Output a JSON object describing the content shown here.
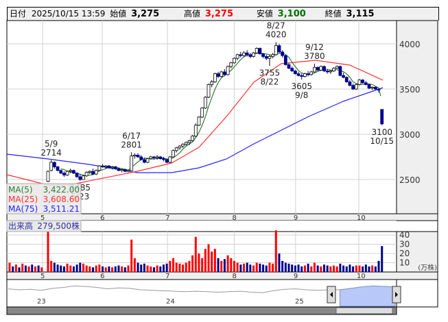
{
  "header": {
    "date_label": "日付",
    "datetime": "2025/10/15 13:59",
    "open_label": "始値",
    "open": "3,275",
    "high_label": "高値",
    "high": "3,275",
    "low_label": "安値",
    "low": "3,100",
    "close_label": "終値",
    "close": "3,115"
  },
  "legend": {
    "ma5_label": "MA(5)",
    "ma5_value": "3,422.00",
    "ma25_label": "MA(25)",
    "ma25_value": "3,608.60",
    "ma75_label": "MA(75)",
    "ma75_value": "3,511.21",
    "volume_label": "出来高",
    "volume_value": "279,500株"
  },
  "colors": {
    "up": "#ff0000",
    "down": "#00008b",
    "ma5": "#2e7d32",
    "ma25": "#ff3030",
    "ma75": "#2020ff",
    "flat": "#999999"
  },
  "chart_data": {
    "type": "candlestick",
    "price_axis": {
      "ticks": [
        "2500",
        "3000",
        "3500",
        "4000"
      ],
      "range": [
        2100,
        4200
      ]
    },
    "volume_axis": {
      "ticks": [
        "10",
        "20",
        "30",
        "40"
      ],
      "unit": "(万株)",
      "range": [
        0,
        42
      ]
    },
    "months": [
      {
        "label": "5",
        "i": -1.7
      },
      {
        "label": "6",
        "i": 16.9
      },
      {
        "label": "7",
        "i": 37.2
      },
      {
        "label": "8",
        "i": 58
      },
      {
        "label": "9",
        "i": 77.1
      },
      {
        "label": "10",
        "i": 96.8
      }
    ],
    "candles": [
      [
        2480,
        2600,
        2470,
        2590
      ],
      [
        2600,
        2714,
        2590,
        2690
      ],
      [
        2690,
        2700,
        2620,
        2640
      ],
      [
        2640,
        2650,
        2590,
        2600
      ],
      [
        2600,
        2610,
        2560,
        2570
      ],
      [
        2570,
        2590,
        2530,
        2550
      ],
      [
        2550,
        2600,
        2540,
        2590
      ],
      [
        2590,
        2620,
        2570,
        2600
      ],
      [
        2600,
        2610,
        2560,
        2570
      ],
      [
        2570,
        2580,
        2520,
        2530
      ],
      [
        2530,
        2560,
        2485,
        2500
      ],
      [
        2500,
        2550,
        2495,
        2540
      ],
      [
        2540,
        2590,
        2530,
        2580
      ],
      [
        2580,
        2600,
        2560,
        2590
      ],
      [
        2590,
        2620,
        2550,
        2560
      ],
      [
        2560,
        2610,
        2550,
        2600
      ],
      [
        2600,
        2660,
        2590,
        2650
      ],
      [
        2650,
        2670,
        2630,
        2640
      ],
      [
        2640,
        2660,
        2620,
        2650
      ],
      [
        2650,
        2660,
        2620,
        2630
      ],
      [
        2630,
        2650,
        2610,
        2640
      ],
      [
        2640,
        2650,
        2610,
        2620
      ],
      [
        2620,
        2630,
        2590,
        2600
      ],
      [
        2600,
        2620,
        2580,
        2610
      ],
      [
        2610,
        2620,
        2580,
        2590
      ],
      [
        2590,
        2610,
        2580,
        2600
      ],
      [
        2600,
        2801,
        2600,
        2760
      ],
      [
        2760,
        2790,
        2730,
        2770
      ],
      [
        2770,
        2790,
        2740,
        2750
      ],
      [
        2750,
        2770,
        2710,
        2720
      ],
      [
        2720,
        2740,
        2680,
        2690
      ],
      [
        2690,
        2740,
        2680,
        2730
      ],
      [
        2730,
        2760,
        2720,
        2750
      ],
      [
        2750,
        2760,
        2720,
        2740
      ],
      [
        2740,
        2770,
        2720,
        2750
      ],
      [
        2750,
        2760,
        2720,
        2730
      ],
      [
        2730,
        2750,
        2700,
        2720
      ],
      [
        2720,
        2730,
        2680,
        2690
      ],
      [
        2690,
        2760,
        2680,
        2750
      ],
      [
        2750,
        2830,
        2740,
        2820
      ],
      [
        2820,
        2860,
        2800,
        2850
      ],
      [
        2850,
        2880,
        2830,
        2870
      ],
      [
        2870,
        2900,
        2850,
        2890
      ],
      [
        2890,
        2920,
        2870,
        2910
      ],
      [
        2910,
        2940,
        2880,
        2930
      ],
      [
        2930,
        2990,
        2920,
        2980
      ],
      [
        2980,
        3120,
        2970,
        3100
      ],
      [
        3100,
        3200,
        3090,
        3190
      ],
      [
        3190,
        3300,
        3180,
        3290
      ],
      [
        3290,
        3420,
        3280,
        3410
      ],
      [
        3410,
        3560,
        3400,
        3550
      ],
      [
        3550,
        3600,
        3520,
        3580
      ],
      [
        3580,
        3680,
        3570,
        3670
      ],
      [
        3670,
        3690,
        3620,
        3640
      ],
      [
        3640,
        3700,
        3630,
        3690
      ],
      [
        3690,
        3720,
        3650,
        3660
      ],
      [
        3660,
        3760,
        3650,
        3750
      ],
      [
        3750,
        3800,
        3730,
        3790
      ],
      [
        3790,
        3850,
        3780,
        3840
      ],
      [
        3840,
        3890,
        3820,
        3880
      ],
      [
        3880,
        3910,
        3850,
        3870
      ],
      [
        3870,
        3920,
        3860,
        3900
      ],
      [
        3900,
        3930,
        3860,
        3880
      ],
      [
        3880,
        3900,
        3840,
        3860
      ],
      [
        3860,
        3910,
        3850,
        3900
      ],
      [
        3900,
        3960,
        3890,
        3950
      ],
      [
        3950,
        3960,
        3880,
        3890
      ],
      [
        3890,
        3900,
        3840,
        3860
      ],
      [
        3860,
        3880,
        3820,
        3840
      ],
      [
        3840,
        3880,
        3755,
        3860
      ],
      [
        3860,
        3900,
        3840,
        3880
      ],
      [
        3880,
        4020,
        3870,
        3980
      ],
      [
        3980,
        4000,
        3900,
        3910
      ],
      [
        3910,
        3930,
        3850,
        3870
      ],
      [
        3870,
        3880,
        3760,
        3770
      ],
      [
        3770,
        3790,
        3720,
        3730
      ],
      [
        3730,
        3750,
        3690,
        3700
      ],
      [
        3700,
        3710,
        3660,
        3670
      ],
      [
        3670,
        3690,
        3640,
        3650
      ],
      [
        3650,
        3670,
        3605,
        3640
      ],
      [
        3640,
        3680,
        3630,
        3670
      ],
      [
        3670,
        3700,
        3640,
        3660
      ],
      [
        3660,
        3700,
        3650,
        3690
      ],
      [
        3690,
        3780,
        3680,
        3740
      ],
      [
        3740,
        3750,
        3700,
        3710
      ],
      [
        3710,
        3760,
        3700,
        3750
      ],
      [
        3750,
        3760,
        3690,
        3700
      ],
      [
        3700,
        3720,
        3670,
        3690
      ],
      [
        3690,
        3710,
        3670,
        3700
      ],
      [
        3700,
        3740,
        3690,
        3730
      ],
      [
        3730,
        3760,
        3720,
        3750
      ],
      [
        3750,
        3760,
        3640,
        3650
      ],
      [
        3650,
        3680,
        3620,
        3630
      ],
      [
        3630,
        3640,
        3570,
        3580
      ],
      [
        3580,
        3600,
        3530,
        3540
      ],
      [
        3540,
        3560,
        3490,
        3500
      ],
      [
        3500,
        3560,
        3490,
        3550
      ],
      [
        3550,
        3610,
        3540,
        3600
      ],
      [
        3600,
        3610,
        3560,
        3570
      ],
      [
        3570,
        3590,
        3540,
        3550
      ],
      [
        3550,
        3560,
        3500,
        3510
      ],
      [
        3510,
        3530,
        3490,
        3520
      ],
      [
        3520,
        3530,
        3490,
        3500
      ],
      [
        3500,
        3510,
        3460,
        3490
      ],
      [
        3275,
        3275,
        3100,
        3115
      ]
    ],
    "pre_volumes": [
      10,
      6,
      8,
      5,
      9,
      7,
      6,
      8,
      6,
      7,
      5
    ],
    "volumes": [
      45,
      12,
      10,
      8,
      7,
      6,
      9,
      7,
      6,
      8,
      10,
      9,
      7,
      6,
      5,
      7,
      8,
      6,
      5,
      6,
      5,
      6,
      7,
      6,
      5,
      7,
      35,
      15,
      10,
      8,
      9,
      7,
      6,
      5,
      7,
      6,
      8,
      9,
      12,
      15,
      10,
      9,
      8,
      10,
      12,
      18,
      38,
      20,
      15,
      25,
      30,
      22,
      25,
      15,
      12,
      14,
      18,
      15,
      12,
      10,
      8,
      9,
      10,
      8,
      7,
      10,
      9,
      8,
      7,
      10,
      9,
      45,
      20,
      12,
      10,
      9,
      8,
      7,
      8,
      6,
      7,
      9,
      6,
      10,
      7,
      6,
      8,
      7,
      6,
      7,
      6,
      9,
      7,
      6,
      8,
      6,
      7,
      7,
      6,
      8,
      6,
      7,
      6,
      12,
      28
    ],
    "ma25": [
      [
        -12.8,
        2553
      ],
      [
        0,
        2439
      ],
      [
        6.4,
        2439
      ],
      [
        27.8,
        2591
      ],
      [
        38.5,
        2682
      ],
      [
        47,
        2856
      ],
      [
        55.6,
        3197
      ],
      [
        64.1,
        3576
      ],
      [
        72.6,
        3780
      ],
      [
        83.3,
        3818
      ],
      [
        94,
        3765
      ],
      [
        104.3,
        3598
      ]
    ],
    "ma75": [
      [
        -12.8,
        2780
      ],
      [
        0,
        2727
      ],
      [
        12.8,
        2667
      ],
      [
        27.8,
        2576
      ],
      [
        38.5,
        2576
      ],
      [
        47,
        2629
      ],
      [
        55.6,
        2727
      ],
      [
        64.1,
        2894
      ],
      [
        72.6,
        3045
      ],
      [
        81.2,
        3197
      ],
      [
        91.9,
        3364
      ],
      [
        104.3,
        3515
      ]
    ],
    "annotations": [
      {
        "i": 1,
        "pos": "above",
        "lines": [
          "5/9",
          "2714"
        ]
      },
      {
        "i": 10,
        "pos": "below",
        "lines": [
          "2485",
          "5/23"
        ]
      },
      {
        "i": 26,
        "pos": "above",
        "lines": [
          "6/17",
          "2801"
        ]
      },
      {
        "i": 69,
        "pos": "below",
        "lines": [
          "3755",
          "8/22"
        ]
      },
      {
        "i": 71,
        "pos": "above",
        "lines": [
          "8/27",
          "4020"
        ]
      },
      {
        "i": 79,
        "pos": "below",
        "lines": [
          "3605",
          "9/8"
        ]
      },
      {
        "i": 83,
        "pos": "above",
        "lines": [
          "9/12",
          "3780"
        ]
      },
      {
        "i": 104,
        "pos": "below",
        "lines": [
          "3100",
          "10/15"
        ]
      }
    ],
    "navigator": {
      "year_labels": [
        "23",
        "24",
        "25"
      ],
      "values": [
        52,
        50,
        51,
        49,
        53,
        55,
        58,
        57,
        55,
        52,
        54,
        53,
        50,
        49,
        48,
        47,
        46,
        47,
        46,
        45,
        46,
        47,
        45,
        44,
        48,
        51,
        52,
        50,
        49,
        50,
        50,
        53,
        56,
        58,
        57,
        56
      ]
    }
  }
}
